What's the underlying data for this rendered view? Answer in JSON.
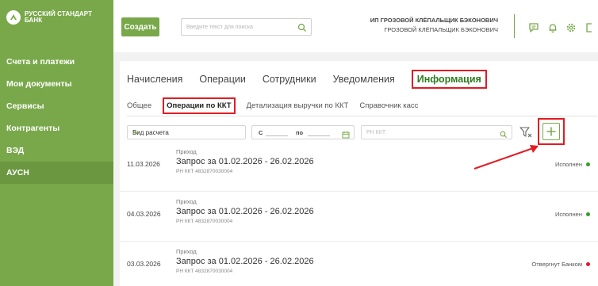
{
  "brand": {
    "name_line1": "РУССКИЙ СТАНДАРТ",
    "name_line2": "БАНК"
  },
  "sidebar": {
    "items": [
      {
        "label": "Счета и платежи"
      },
      {
        "label": "Мои документы"
      },
      {
        "label": "Сервисы"
      },
      {
        "label": "Контрагенты"
      },
      {
        "label": "ВЭД"
      },
      {
        "label": "АУСН"
      }
    ],
    "active_index": 5
  },
  "topbar": {
    "create_label": "Создать",
    "search_placeholder": "Введите текст для поиска",
    "user_line1": "ИП ГРОЗОВОЙ КЛЁПАЛЬЩИК БЭКОНОВИЧ",
    "user_line2": "ГРОЗОВОЙ КЛЁПАЛЬЩИК БЭКОНОВИЧ"
  },
  "tabs": [
    {
      "label": "Начисления"
    },
    {
      "label": "Операции"
    },
    {
      "label": "Сотрудники"
    },
    {
      "label": "Уведомления"
    },
    {
      "label": "Информация"
    }
  ],
  "subtabs": [
    {
      "label": "Общее"
    },
    {
      "label": "Операции по ККТ"
    },
    {
      "label": "Детализация выручки по ККТ"
    },
    {
      "label": "Справочник касс"
    }
  ],
  "filters": {
    "calc_type_value": "Вид расчета",
    "date_from_label": "С",
    "date_to_label": "по",
    "rn_placeholder": "РН ККТ"
  },
  "rows": [
    {
      "date": "11.03.2026",
      "type": "Приход",
      "title": "Запрос за 01.02.2026 - 26.02.2026",
      "sub": "РН ККТ 4832870030004",
      "status": "Исполнен",
      "status_color": "#3a9b2a"
    },
    {
      "date": "04.03.2026",
      "type": "Приход",
      "title": "Запрос за 01.02.2026 - 26.02.2026",
      "sub": "РН ККТ 4832870030004",
      "status": "Исполнен",
      "status_color": "#3a9b2a"
    },
    {
      "date": "03.03.2026",
      "type": "Приход",
      "title": "Запрос за 01.02.2026 - 26.02.2026",
      "sub": "РН ККТ 4832870030004",
      "status": "Отвергнут Банком",
      "status_color": "#e31b23"
    }
  ],
  "colors": {
    "brand_green": "#79a84a",
    "highlight_red": "#e31b23",
    "active_tab_green": "#2e7d1f"
  }
}
